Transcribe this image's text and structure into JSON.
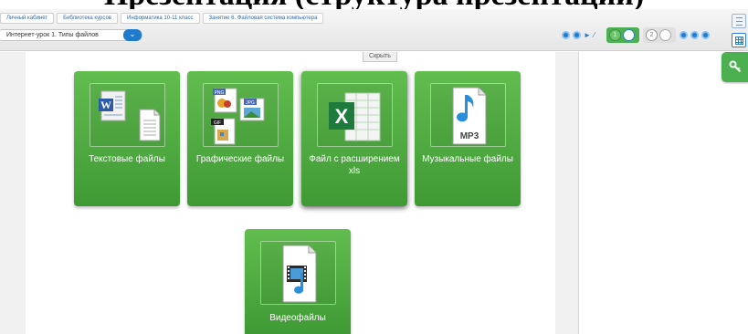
{
  "top_title": "Презентация (структура презентации)",
  "breadcrumb": [
    "Личный кабинет",
    "Библиотека курсов",
    "Информатика 10-11 класс",
    "Занятие 6. Файловая система компьютера"
  ],
  "lesson_select": {
    "value": "Интернет-урок 1. Типы файлов",
    "icon": "chevron-down-icon"
  },
  "nav": {
    "pages": [
      "1",
      "2"
    ]
  },
  "hide_button": "Скрыть",
  "tiles": [
    {
      "label": "Текстовые файлы",
      "icon": "word-document-icon"
    },
    {
      "label": "Графические файлы",
      "icon": "image-files-icon"
    },
    {
      "label": "Файл с расширением xls",
      "icon": "excel-file-icon"
    },
    {
      "label": "Музыкальные файлы",
      "icon": "mp3-file-icon"
    },
    {
      "label": "Видеофайлы",
      "icon": "video-file-icon"
    }
  ],
  "icon_labels": {
    "png": "PNG",
    "jpg": "JPG",
    "gif": "GIF",
    "mp3": "MP3"
  },
  "colors": {
    "tile_green": "#4caf50",
    "accent_blue": "#1f7ccc"
  }
}
